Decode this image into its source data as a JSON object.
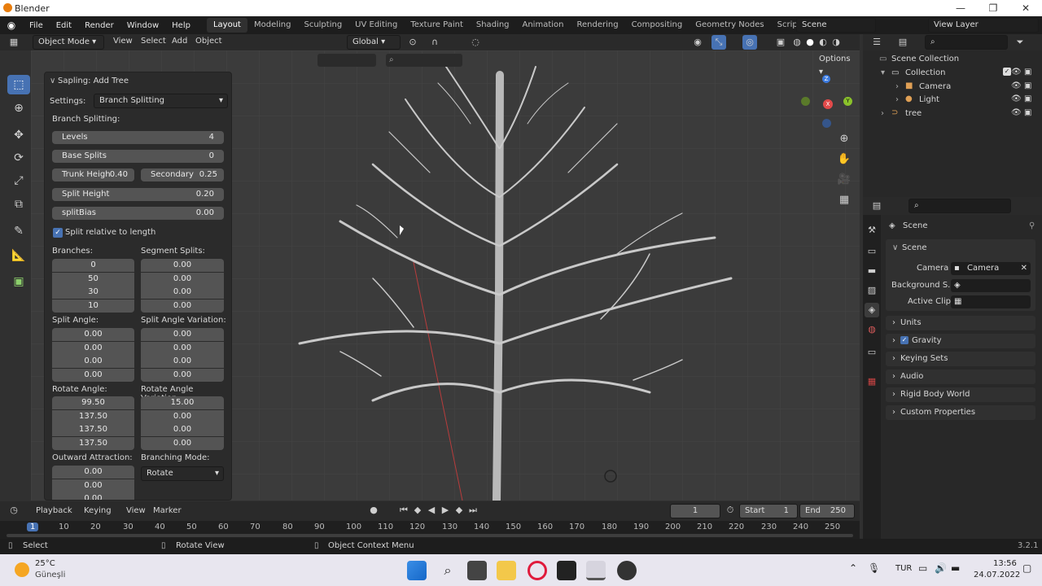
{
  "window": {
    "title": "Blender",
    "min": "—",
    "max": "❐",
    "close": "✕"
  },
  "menus": [
    "File",
    "Edit",
    "Render",
    "Window",
    "Help"
  ],
  "workspaces": [
    "Layout",
    "Modeling",
    "Sculpting",
    "UV Editing",
    "Texture Paint",
    "Shading",
    "Animation",
    "Rendering",
    "Compositing",
    "Geometry Nodes",
    "Scripting"
  ],
  "active_workspace": "Layout",
  "scene_name": "Scene",
  "view_layer": "View Layer",
  "viewport_header": {
    "mode": "Object Mode",
    "view": "View",
    "select": "Select",
    "add": "Add",
    "object": "Object",
    "orientation": "Global",
    "options": "Options"
  },
  "panel": {
    "title": "Sapling: Add Tree",
    "settings_label": "Settings:",
    "settings_value": "Branch Splitting",
    "section": "Branch Splitting:",
    "levels": {
      "label": "Levels",
      "value": "4"
    },
    "base_splits": {
      "label": "Base Splits",
      "value": "0"
    },
    "trunk_height": {
      "label": "Trunk Heigh",
      "value": "0.40"
    },
    "secondary": {
      "label": "Secondary",
      "value": "0.25"
    },
    "split_height": {
      "label": "Split Height",
      "value": "0.20"
    },
    "split_bias": {
      "label": "splitBias",
      "value": "0.00"
    },
    "split_relative": "Split relative to length",
    "branches_label": "Branches:",
    "branches": [
      "0",
      "50",
      "30",
      "10"
    ],
    "segment_splits_label": "Segment Splits:",
    "segment_splits": [
      "0.00",
      "0.00",
      "0.00",
      "0.00"
    ],
    "split_angle_label": "Split Angle:",
    "split_angle": [
      "0.00",
      "0.00",
      "0.00",
      "0.00"
    ],
    "split_angle_var_label": "Split Angle Variation:",
    "split_angle_var": [
      "0.00",
      "0.00",
      "0.00",
      "0.00"
    ],
    "rotate_angle_label": "Rotate Angle:",
    "rotate_angle": [
      "99.50",
      "137.50",
      "137.50",
      "137.50"
    ],
    "rotate_angle_var_label": "Rotate Angle Variation:",
    "rotate_angle_var": [
      "15.00",
      "0.00",
      "0.00",
      "0.00"
    ],
    "outward_label": "Outward Attraction:",
    "outward": [
      "0.00",
      "0.00",
      "0.00"
    ],
    "branching_mode_label": "Branching Mode:",
    "branching_mode": "Rotate"
  },
  "outliner": {
    "root": "Scene Collection",
    "collection": "Collection",
    "items": [
      "Camera",
      "Light",
      "tree"
    ]
  },
  "properties": {
    "header": "Scene",
    "section": "Scene",
    "camera_label": "Camera",
    "camera_value": "Camera",
    "background_label": "Background S...",
    "active_clip_label": "Active Clip",
    "collapsed": [
      "Units",
      "Gravity",
      "Keying Sets",
      "Audio",
      "Rigid Body World",
      "Custom Properties"
    ]
  },
  "timeline": {
    "playback": "Playback",
    "keying": "Keying",
    "view": "View",
    "marker": "Marker",
    "current_frame": "1",
    "start_label": "Start",
    "start": "1",
    "end_label": "End",
    "end": "250",
    "ticks": [
      "1",
      "10",
      "20",
      "30",
      "40",
      "50",
      "60",
      "70",
      "80",
      "90",
      "100",
      "110",
      "120",
      "130",
      "140",
      "150",
      "160",
      "170",
      "180",
      "190",
      "200",
      "210",
      "220",
      "230",
      "240",
      "250"
    ]
  },
  "status": {
    "select": "Select",
    "rotate": "Rotate View",
    "context": "Object Context Menu",
    "version": "3.2.1"
  },
  "taskbar": {
    "temp": "25°C",
    "weather": "Güneşli",
    "lang": "TUR",
    "time": "13:56",
    "date": "24.07.2022"
  },
  "colors": {
    "accent": "#4772b3",
    "axis_x": "#e24a4a",
    "axis_y": "#8ac22b",
    "axis_z": "#3c7be0"
  }
}
